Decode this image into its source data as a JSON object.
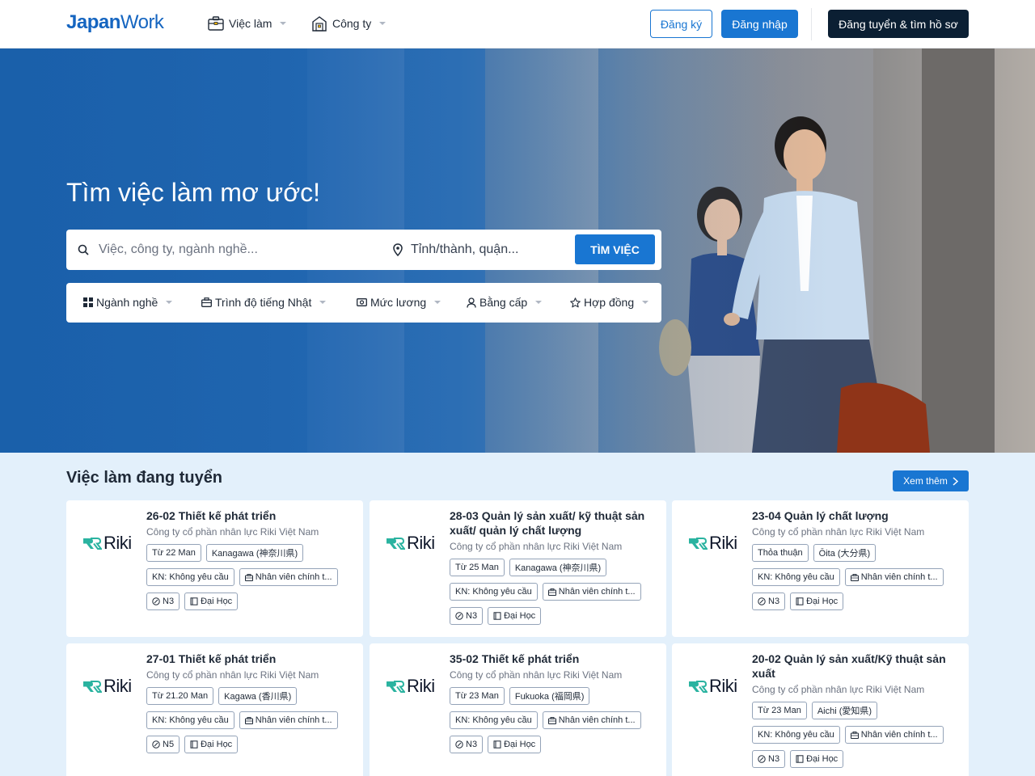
{
  "header": {
    "logo_main": "Japan",
    "logo_sub": "Work",
    "nav": [
      {
        "label": "Việc làm",
        "icon": "briefcase-icon"
      },
      {
        "label": "Công ty",
        "icon": "building-icon"
      }
    ],
    "register_label": "Đăng ký",
    "login_label": "Đăng nhập",
    "employer_label": "Đăng tuyển & tìm hồ sơ"
  },
  "hero": {
    "title": "Tìm việc làm mơ ước!",
    "search_placeholder": "Việc, công ty, ngành nghề...",
    "location_placeholder": "Tỉnh/thành, quận...",
    "search_button": "TÌM VIỆC",
    "filters": [
      {
        "label": "Ngành nghề",
        "icon": "grid-icon"
      },
      {
        "label": "Trình độ tiếng Nhật",
        "icon": "briefcase-icon"
      },
      {
        "label": "Mức lương",
        "icon": "money-icon"
      },
      {
        "label": "Bằng cấp",
        "icon": "user-icon"
      },
      {
        "label": "Hợp đồng",
        "icon": "star-icon"
      }
    ]
  },
  "jobs": {
    "section_title": "Việc làm đang tuyển",
    "more_label": "Xem thêm",
    "company_logo_text": "Riki",
    "items": [
      {
        "title": "26-02 Thiết kế phát triển",
        "company": "Công ty cổ phần nhân lực Riki Việt Nam",
        "salary": "Từ 22 Man",
        "location": "Kanagawa (神奈川県)",
        "experience": "KN: Không yêu cầu",
        "type": "Nhân viên chính t...",
        "jlpt": "N3",
        "degree": "Đại Học"
      },
      {
        "title": "28-03 Quản lý sản xuất/ kỹ thuật sản xuất/ quản lý chất lượng",
        "company": "Công ty cổ phần nhân lực Riki Việt Nam",
        "salary": "Từ 25 Man",
        "location": "Kanagawa (神奈川県)",
        "experience": "KN: Không yêu cầu",
        "type": "Nhân viên chính t...",
        "jlpt": "N3",
        "degree": "Đại Học"
      },
      {
        "title": "23-04 Quản lý chất lượng",
        "company": "Công ty cổ phần nhân lực Riki Việt Nam",
        "salary": "Thỏa thuận",
        "location": "Ōita (大分県)",
        "experience": "KN: Không yêu cầu",
        "type": "Nhân viên chính t...",
        "jlpt": "N3",
        "degree": "Đại Học"
      },
      {
        "title": "27-01 Thiết kế phát triển",
        "company": "Công ty cổ phần nhân lực Riki Việt Nam",
        "salary": "Từ 21.20 Man",
        "location": "Kagawa (香川県)",
        "experience": "KN: Không yêu cầu",
        "type": "Nhân viên chính t...",
        "jlpt": "N5",
        "degree": "Đại Học"
      },
      {
        "title": "35-02 Thiết kế phát triển",
        "company": "Công ty cổ phần nhân lực Riki Việt Nam",
        "salary": "Từ 23 Man",
        "location": "Fukuoka (福岡県)",
        "experience": "KN: Không yêu cầu",
        "type": "Nhân viên chính t...",
        "jlpt": "N3",
        "degree": "Đại Học"
      },
      {
        "title": "20-02 Quản lý sản xuất/Kỹ thuật sản xuất",
        "company": "Công ty cổ phần nhân lực Riki Việt Nam",
        "salary": "Từ 23 Man",
        "location": "Aichi (愛知県)",
        "experience": "KN: Không yêu cầu",
        "type": "Nhân viên chính t...",
        "jlpt": "N3",
        "degree": "Đại Học"
      }
    ]
  },
  "colors": {
    "brand": "#1565c0",
    "primary": "#1976d2",
    "dark_button": "#0b1f33",
    "section_bg": "#e3f0fb"
  }
}
